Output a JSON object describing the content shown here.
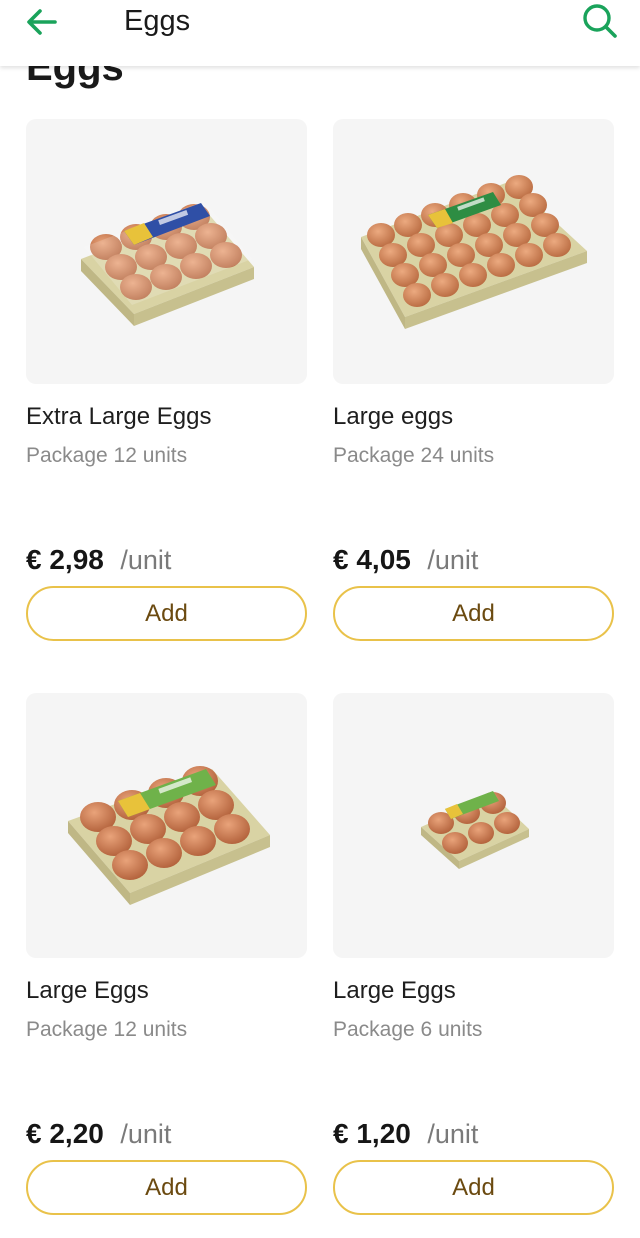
{
  "header": {
    "title": "Eggs",
    "back_icon": "arrow-left-icon",
    "search_icon": "search-icon",
    "accent_color": "#1aa35b"
  },
  "section": {
    "title": "Eggs"
  },
  "products": [
    {
      "name": "Extra Large Eggs",
      "package": "Package 12 units",
      "price": "€ 2,98",
      "unit": "/unit",
      "add_label": "Add",
      "image": "egg-carton-12-blue-label"
    },
    {
      "name": "Large eggs",
      "package": "Package 24 units",
      "price": "€ 4,05",
      "unit": "/unit",
      "add_label": "Add",
      "image": "egg-carton-24-green-label"
    },
    {
      "name": "Large Eggs",
      "package": "Package 12 units",
      "price": "€ 2,20",
      "unit": "/unit",
      "add_label": "Add",
      "image": "egg-carton-12-green-label"
    },
    {
      "name": "Large Eggs",
      "package": "Package 6 units",
      "price": "€ 1,20",
      "unit": "/unit",
      "add_label": "Add",
      "image": "egg-carton-6-green-label"
    }
  ],
  "colors": {
    "add_border": "#e9c24a",
    "add_text": "#6b4a10",
    "image_bg": "#f5f5f5"
  }
}
